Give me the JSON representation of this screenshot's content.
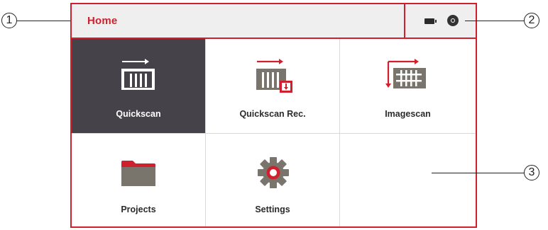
{
  "header": {
    "title": "Home",
    "status_icons": [
      "battery-icon",
      "disc-icon"
    ]
  },
  "tiles": [
    {
      "label": "Quickscan",
      "icon": "quickscan-icon",
      "selected": true
    },
    {
      "label": "Quickscan Rec.",
      "icon": "quickscan-rec-icon",
      "selected": false
    },
    {
      "label": "Imagescan",
      "icon": "imagescan-icon",
      "selected": false
    },
    {
      "label": "Projects",
      "icon": "folder-icon",
      "selected": false
    },
    {
      "label": "Settings",
      "icon": "gear-icon",
      "selected": false
    },
    {
      "label": "",
      "icon": "",
      "selected": false
    }
  ],
  "callouts": [
    "1",
    "2",
    "3"
  ],
  "colors": {
    "accent": "#d0202e",
    "header_bg": "#f0efef",
    "selected_tile_bg": "#454349",
    "icon_gray": "#7a756c"
  }
}
